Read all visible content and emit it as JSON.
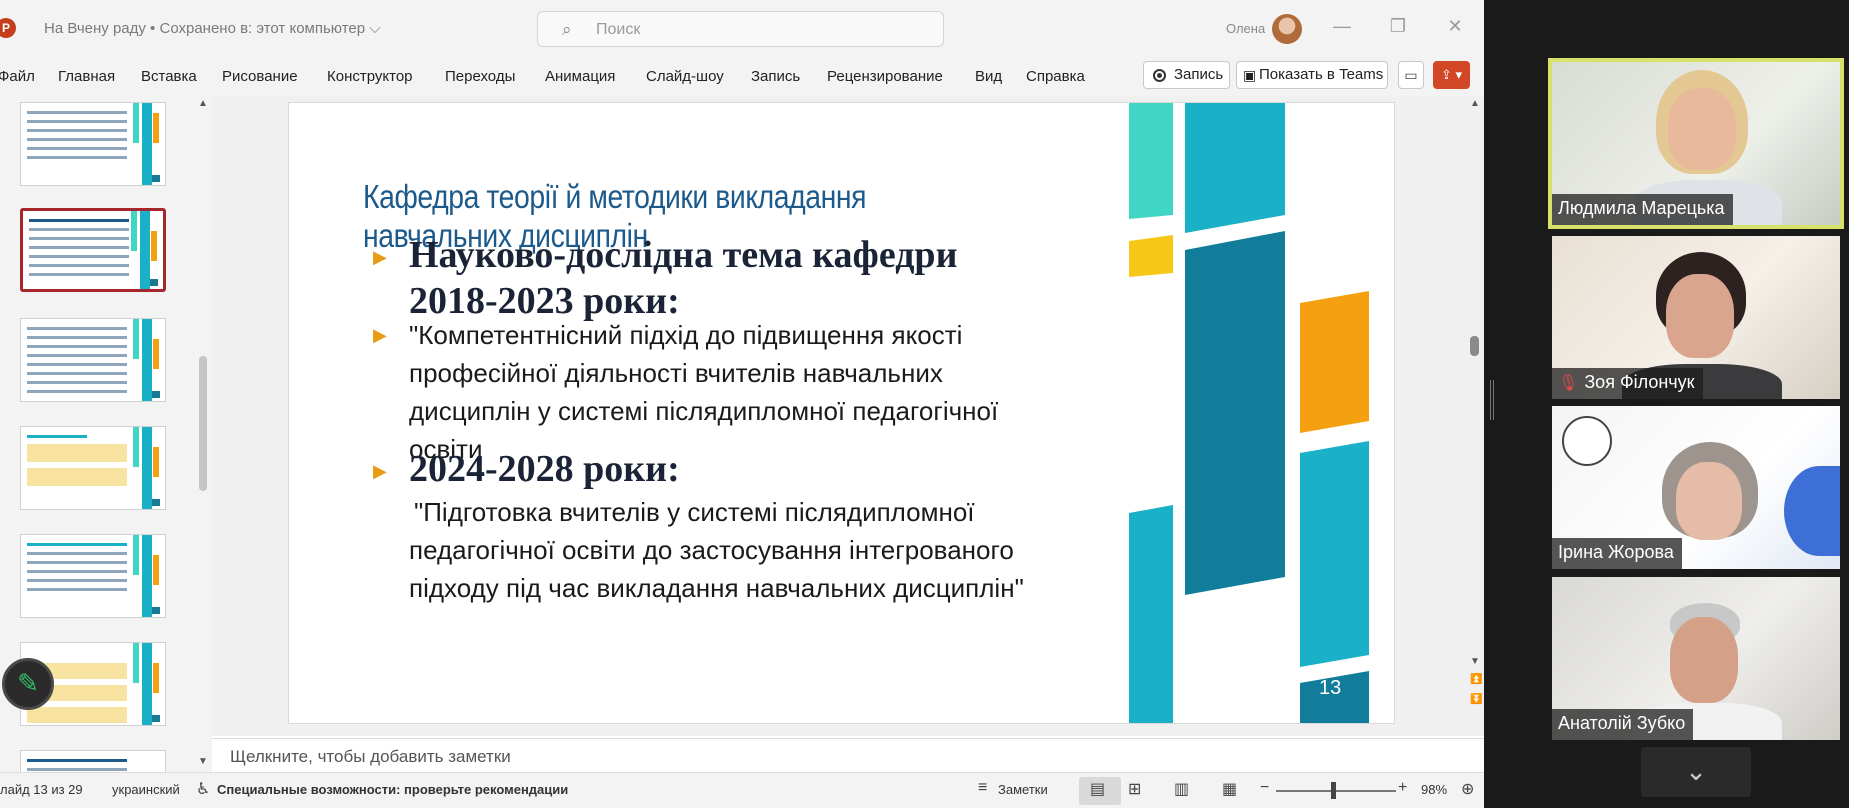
{
  "titlebar": {
    "app_logo": "P",
    "doc_title": "На Вчену раду • Сохранено в: этот компьютер ⌵",
    "search_placeholder": "Поиск",
    "user_name": "Олена",
    "minimize": "—",
    "restore": "❐",
    "close": "✕"
  },
  "menu": {
    "items": [
      "Файл",
      "Главная",
      "Вставка",
      "Рисование",
      "Конструктор",
      "Переходы",
      "Анимация",
      "Слайд-шоу",
      "Запись",
      "Рецензирование",
      "Вид",
      "Справка"
    ],
    "record_label": "Запись",
    "teams_label": "Показать в Teams"
  },
  "slide": {
    "title": "Кафедра теорії й методики викладання навчальних дисциплін",
    "heading1_line1": "Науково-дослідна тема кафедри",
    "heading1_line2": "2018-2023 роки:",
    "topic1_lines": [
      "\"Компетентнісний підхід до підвищення якості",
      "професійної діяльності вчителів навчальних",
      "дисциплін у системі післядипломної педагогічної",
      "освіти"
    ],
    "heading2": "2024-2028 роки:",
    "topic2_lines": [
      "\"Підготовка вчителів у системі післядипломної",
      "педагогічної освіти до застосування інтегрованого",
      "підходу під час викладання навчальних дисциплін\""
    ],
    "number": "13",
    "colors": {
      "title": "#1d5a8c",
      "bullet": "#e89b14",
      "teal": "#1ab0c8",
      "dark_teal": "#127d9a",
      "orange": "#f5a011",
      "yellow": "#f7c718",
      "mint": "#3fd6c6"
    }
  },
  "notes": {
    "placeholder": "Щелкните, чтобы добавить заметки"
  },
  "status": {
    "slide_info": "лайд 13 из 29",
    "language": "украинский",
    "accessibility": "Специальные возможности: проверьте рекомендации",
    "notes_label": "Заметки",
    "zoom": "98%"
  },
  "participants": [
    {
      "name": "Людмила Марецька",
      "muted": false,
      "speaking": true
    },
    {
      "name": "Зоя Філончук",
      "muted": true,
      "speaking": false
    },
    {
      "name": "Ірина Жорова",
      "muted": false,
      "speaking": false
    },
    {
      "name": "Анатолій Зубко",
      "muted": false,
      "speaking": false
    }
  ],
  "icons": {
    "search": "search-icon",
    "pen": "pen-icon",
    "collapse": "chevron-down-icon",
    "mute": "mic-off-icon"
  }
}
